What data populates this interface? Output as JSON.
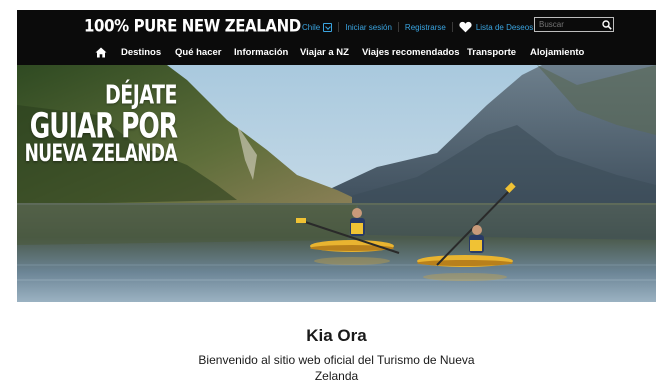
{
  "header": {
    "brand": "100% PURE NEW ZEALAND",
    "country": "Chile",
    "login": "Iniciar sesión",
    "register": "Registrarse",
    "wishlist": "Lista de Deseos",
    "search_placeholder": "Buscar"
  },
  "nav": {
    "items": [
      "Destinos",
      "Qué hacer",
      "Información",
      "Viajar a NZ",
      "Viajes recomendados",
      "Transporte",
      "Alojamiento"
    ]
  },
  "hero": {
    "line1": "DÉJATE",
    "line2": "GUIAR POR",
    "line3": "NUEVA ZELANDA"
  },
  "welcome": {
    "title": "Kia Ora",
    "subtitle": "Bienvenido al sitio web oficial del Turismo de Nueva Zelanda"
  },
  "colors": {
    "header_bg": "#0b0b0b",
    "link_blue": "#3aa4e0",
    "kayak_yellow": "#e9b430"
  },
  "icons": {
    "home": "home-icon",
    "heart": "heart-icon",
    "search": "search-icon",
    "dropdown": "chevron-down-icon"
  }
}
